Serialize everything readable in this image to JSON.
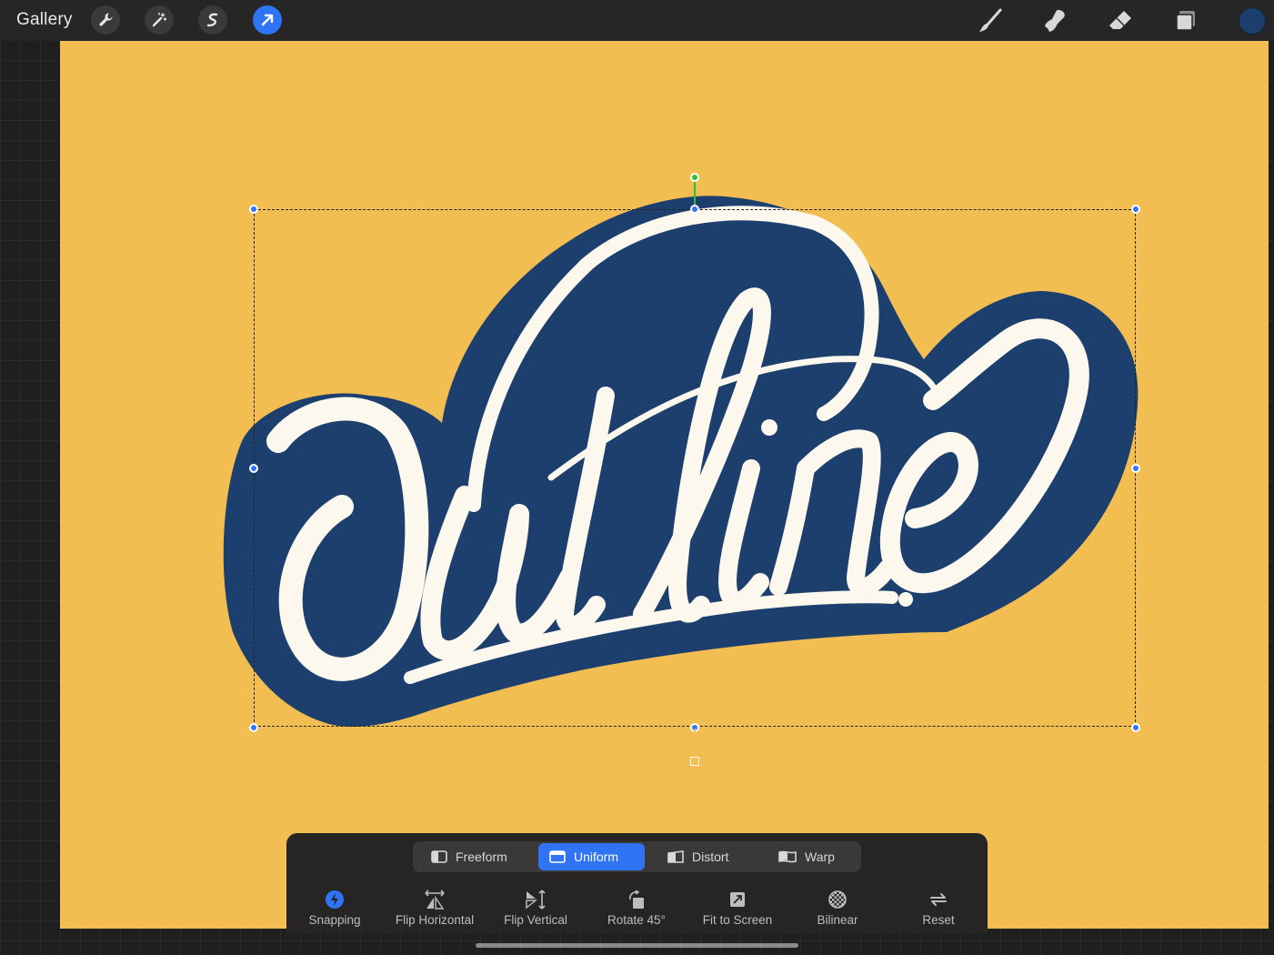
{
  "app": {
    "name": "Procreate"
  },
  "topbar": {
    "gallery_label": "Gallery",
    "left_tools": [
      "wrench-icon",
      "magic-wand-icon",
      "selection-s-icon",
      "transform-arrow-icon"
    ],
    "right_tools": [
      "brush-icon",
      "smudge-icon",
      "eraser-icon",
      "layers-icon"
    ],
    "current_color": "#1d3f6e"
  },
  "canvas": {
    "background_color": "#f2bd51",
    "artwork_text": "Outline",
    "artwork_fill": "#fcf8ee",
    "outline_color": "#1d3f6e"
  },
  "transform": {
    "modes": [
      {
        "label": "Freeform",
        "active": false
      },
      {
        "label": "Uniform",
        "active": true
      },
      {
        "label": "Distort",
        "active": false
      },
      {
        "label": "Warp",
        "active": false
      }
    ],
    "actions": [
      {
        "label": "Snapping",
        "icon": "snapping-icon",
        "active": true
      },
      {
        "label": "Flip Horizontal",
        "icon": "flip-horizontal-icon",
        "active": false
      },
      {
        "label": "Flip Vertical",
        "icon": "flip-vertical-icon",
        "active": false
      },
      {
        "label": "Rotate 45°",
        "icon": "rotate-icon",
        "active": false
      },
      {
        "label": "Fit to Screen",
        "icon": "fit-to-screen-icon",
        "active": false
      },
      {
        "label": "Bilinear",
        "icon": "bilinear-icon",
        "active": false
      },
      {
        "label": "Reset",
        "icon": "reset-icon",
        "active": false
      }
    ]
  }
}
